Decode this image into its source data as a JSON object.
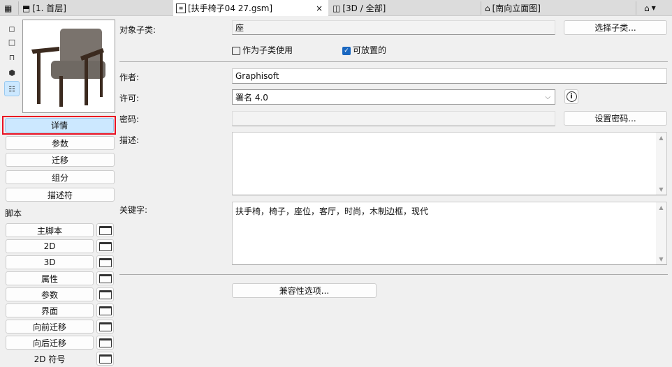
{
  "tabs": [
    {
      "label": "[1. 首层]"
    },
    {
      "label": "[扶手椅子04 27.gsm]",
      "active": true
    },
    {
      "label": "[3D / 全部]"
    },
    {
      "label": "[南向立面图]"
    }
  ],
  "left": {
    "nav": [
      "详情",
      "参数",
      "迁移",
      "组分",
      "描述符"
    ],
    "scripts_label": "脚本",
    "scripts": [
      "主脚本",
      "2D",
      "3D",
      "属性",
      "参数",
      "界面",
      "向前迁移",
      "向后迁移",
      "2D 符号"
    ]
  },
  "form": {
    "subtype_label": "对象子类:",
    "subtype_value": "座",
    "select_subtype": "选择子类...",
    "use_as_subtype": "作为子类使用",
    "use_as_subtype_checked": false,
    "placeable": "可放置的",
    "placeable_checked": true,
    "author_label": "作者:",
    "author_value": "Graphisoft",
    "license_label": "许可:",
    "license_value": "署名 4.0",
    "password_label": "密码:",
    "password_value": "",
    "set_password": "设置密码...",
    "description_label": "描述:",
    "description_value": "",
    "keywords_label": "关键字:",
    "keywords_value": "扶手椅，椅子，座位，客厅，时尚，木制边框，现代",
    "compat_button": "兼容性选项..."
  },
  "colors": {
    "selected_bg": "#cce8ff",
    "highlight": "#e81123",
    "checkbox": "#1a67c0"
  }
}
